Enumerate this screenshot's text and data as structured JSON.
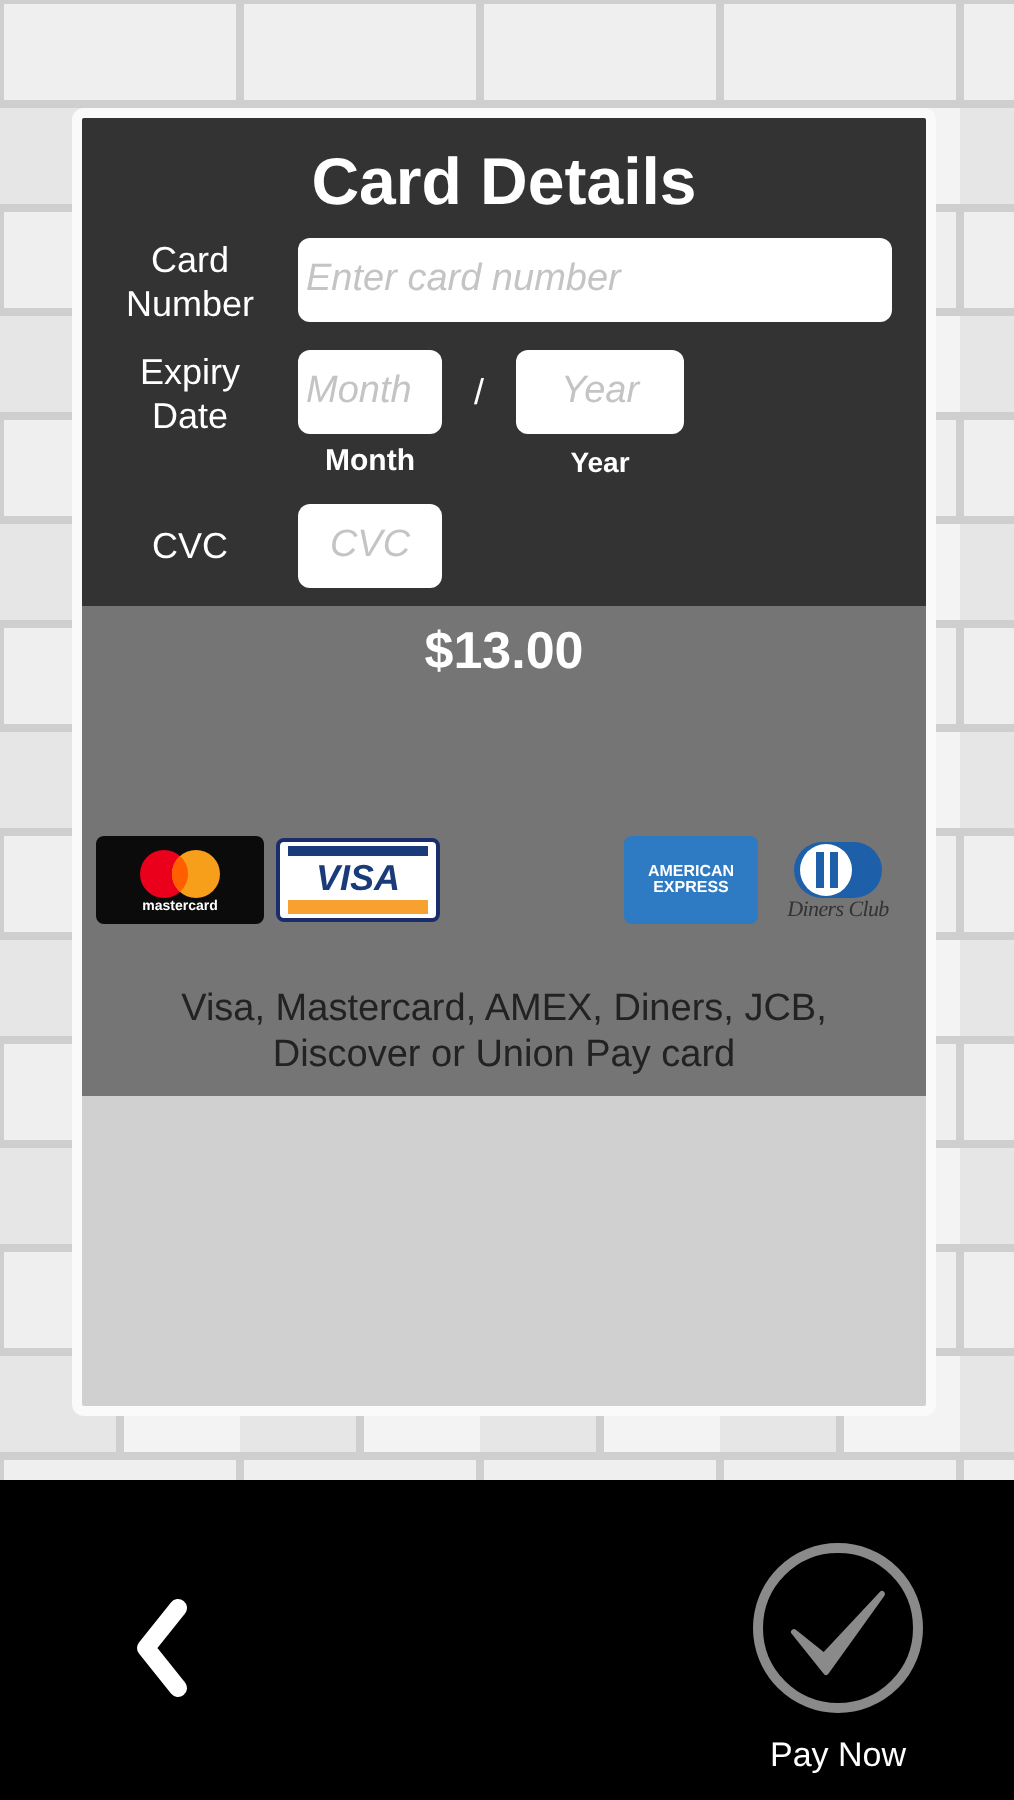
{
  "card": {
    "title": "Card Details",
    "card_number": {
      "label": "Card Number",
      "placeholder": "Enter card number"
    },
    "expiry": {
      "label": "Expiry Date",
      "separator": "/",
      "month": {
        "placeholder": "Month",
        "caption": "Month"
      },
      "year": {
        "placeholder": "Year",
        "caption": "Year"
      }
    },
    "cvc": {
      "label": "CVC",
      "placeholder": "CVC"
    }
  },
  "amount": "$13.00",
  "logos": [
    {
      "kind": "mastercard",
      "text": "mastercard"
    },
    {
      "kind": "visa",
      "text": "VISA"
    },
    {
      "kind": "amex",
      "text": "AMERICAN EXPRESS"
    },
    {
      "kind": "diners",
      "text": "Diners Club"
    }
  ],
  "accepted_note": "Visa, Mastercard, AMEX, Diners, JCB, Discover or Union Pay card",
  "pay_button": {
    "label": "Pay Now"
  }
}
